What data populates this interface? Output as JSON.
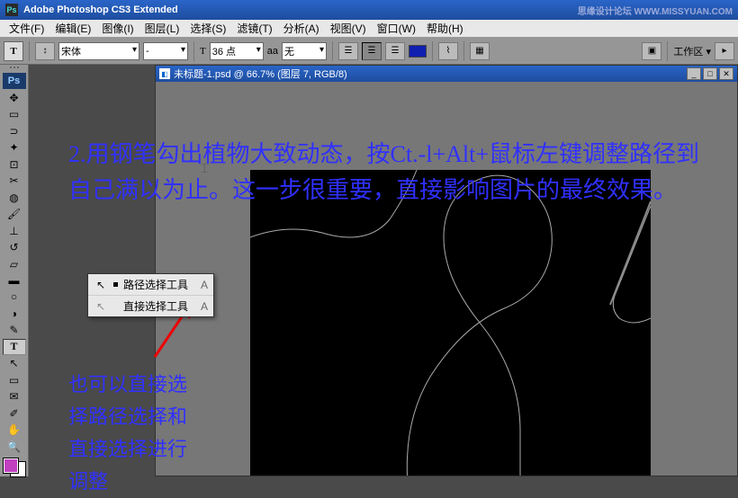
{
  "app": {
    "title": "Adobe Photoshop CS3 Extended",
    "logo": "Ps",
    "watermark": "思缘设计论坛   WWW.MISSYUAN.COM"
  },
  "menu": {
    "items": [
      "文件(F)",
      "编辑(E)",
      "图像(I)",
      "图层(L)",
      "选择(S)",
      "滤镜(T)",
      "分析(A)",
      "视图(V)",
      "窗口(W)",
      "帮助(H)"
    ]
  },
  "options": {
    "tool_glyph": "T",
    "font_family": "宋体",
    "font_style": "-",
    "font_size_icon": "T",
    "font_size": "36 点",
    "aa_label": "aa",
    "aa_value": "无",
    "color_hex": "#1020b0",
    "workspace_label": "工作区 ▾"
  },
  "toolbox": {
    "active_tool": "text-tool",
    "tools": [
      "move-tool",
      "marquee-tool",
      "lasso-tool",
      "wand-tool",
      "crop-tool",
      "slice-tool",
      "healing-tool",
      "brush-tool",
      "stamp-tool",
      "history-brush-tool",
      "eraser-tool",
      "gradient-tool",
      "blur-tool",
      "dodge-tool",
      "pen-tool",
      "text-tool",
      "path-select-tool",
      "shape-tool",
      "notes-tool",
      "eyedropper-tool",
      "hand-tool",
      "zoom-tool"
    ],
    "fg_color": "#c040c0",
    "bg_color": "#ffffff"
  },
  "document": {
    "title": "未标题-1.psd @ 66.7% (图层 7, RGB/8)"
  },
  "tool_popup": {
    "items": [
      {
        "icon": "↖",
        "label": "路径选择工具",
        "shortcut": "A"
      },
      {
        "icon": "↖",
        "label": "直接选择工具",
        "shortcut": "A"
      }
    ]
  },
  "annotations": {
    "step2": "2.用钢笔勾出植物大致动态，按Ct.-l+Alt+鼠标左键调整路径到自己满以为止。这一步很重要，直接影响图片的最终效果。",
    "tip2": "也可以直接选择路径选择和直接选择进行调整"
  }
}
